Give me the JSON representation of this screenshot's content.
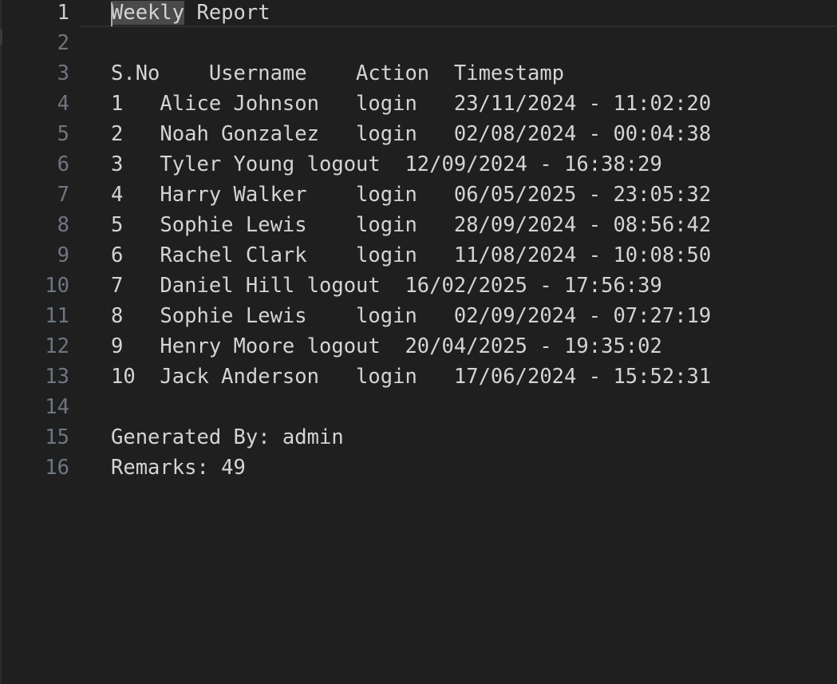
{
  "lines": [
    {
      "number": "1",
      "highlight": "Weekly",
      "text": " Report"
    },
    {
      "number": "2",
      "text": ""
    },
    {
      "number": "3",
      "text": "S.No    Username    Action  Timestamp"
    },
    {
      "number": "4",
      "text": "1   Alice Johnson   login   23/11/2024 - 11:02:20"
    },
    {
      "number": "5",
      "text": "2   Noah Gonzalez   login   02/08/2024 - 00:04:38"
    },
    {
      "number": "6",
      "text": "3   Tyler Young logout  12/09/2024 - 16:38:29"
    },
    {
      "number": "7",
      "text": "4   Harry Walker    login   06/05/2025 - 23:05:32"
    },
    {
      "number": "8",
      "text": "5   Sophie Lewis    login   28/09/2024 - 08:56:42"
    },
    {
      "number": "9",
      "text": "6   Rachel Clark    login   11/08/2024 - 10:08:50"
    },
    {
      "number": "10",
      "text": "7   Daniel Hill logout  16/02/2025 - 17:56:39"
    },
    {
      "number": "11",
      "text": "8   Sophie Lewis    login   02/09/2024 - 07:27:19"
    },
    {
      "number": "12",
      "text": "9   Henry Moore logout  20/04/2025 - 19:35:02"
    },
    {
      "number": "13",
      "text": "10  Jack Anderson   login   17/06/2024 - 15:52:31"
    },
    {
      "number": "14",
      "text": ""
    },
    {
      "number": "15",
      "text": "Generated By: admin"
    },
    {
      "number": "16",
      "text": "Remarks: 49"
    }
  ]
}
